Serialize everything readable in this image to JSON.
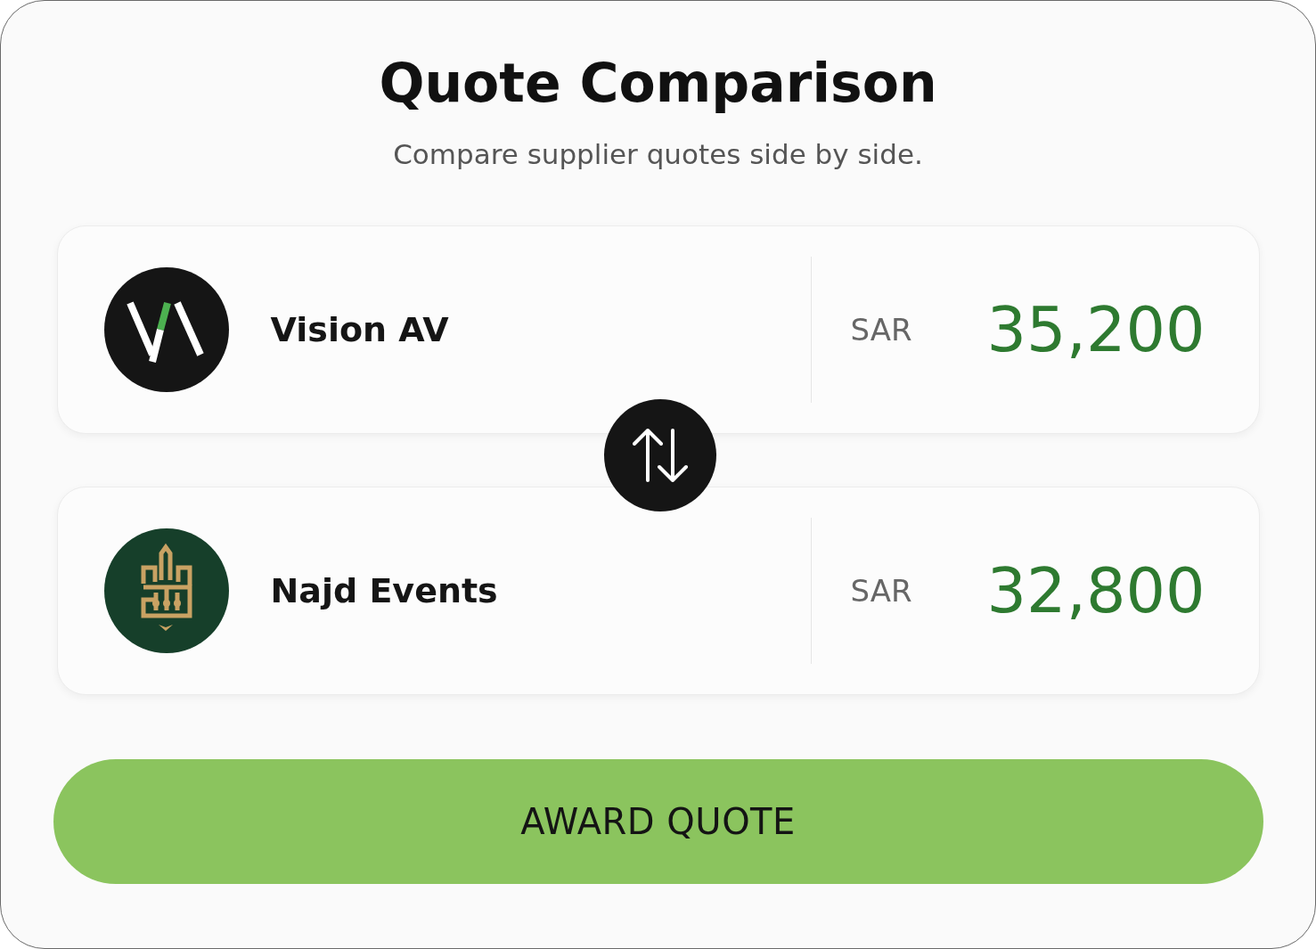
{
  "header": {
    "title": "Quote Comparison",
    "subtitle": "Compare supplier quotes side by side."
  },
  "quotes": [
    {
      "kind": "monogram",
      "supplier": "Vision AV",
      "currency": "SAR",
      "amount": "35,200"
    },
    {
      "kind": "emblem",
      "supplier": "Najd Events",
      "currency": "SAR",
      "amount": "32,800"
    }
  ],
  "award_button": {
    "label": "AWARD QUOTE"
  }
}
